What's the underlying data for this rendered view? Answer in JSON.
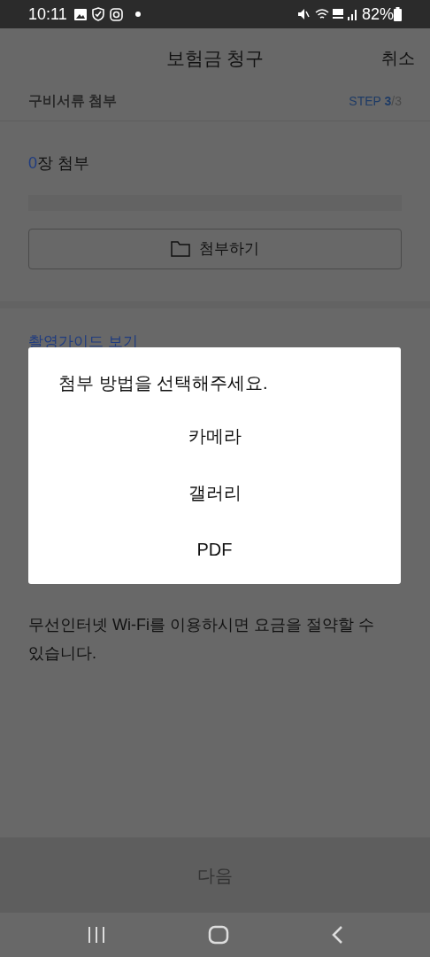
{
  "status_bar": {
    "time": "10:11",
    "battery": "82%"
  },
  "header": {
    "title": "보험금 청구",
    "cancel": "취소"
  },
  "section": {
    "title": "구비서류 첨부",
    "step_label": "STEP",
    "step_current": "3",
    "step_total": "/3"
  },
  "attach": {
    "count": "0",
    "count_label": "장 첨부",
    "button": "첨부하기"
  },
  "guide_link": "촬영가이드 보기",
  "notice": "무선인터넷 Wi-Fi를 이용하시면 요금을 절약할 수 있습니다.",
  "next_button": {
    "label": "다음",
    "disabled": true
  },
  "dialog": {
    "title": "첨부 방법을 선택해주세요.",
    "options": [
      "카메라",
      "갤러리",
      "PDF"
    ]
  }
}
